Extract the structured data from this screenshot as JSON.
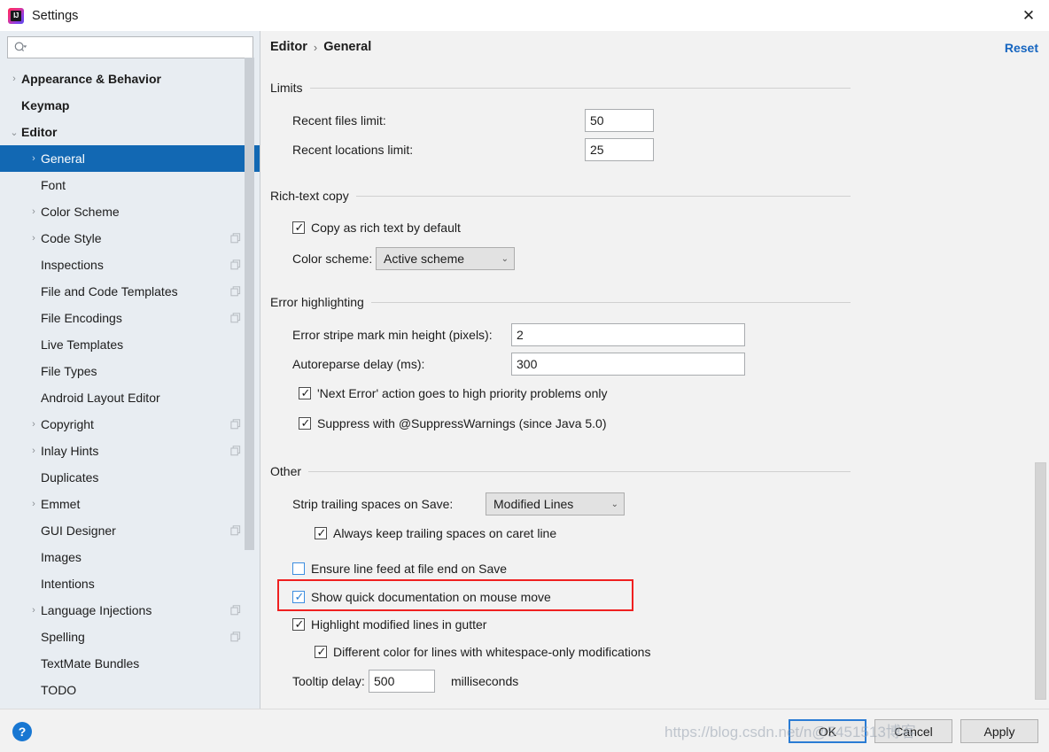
{
  "window": {
    "title": "Settings",
    "logo_text": "IJ",
    "close_label": "✕"
  },
  "sidebar": {
    "search": {
      "placeholder": "",
      "value": "",
      "icon": "search-icon"
    },
    "items": [
      {
        "label": "Appearance & Behavior",
        "level": 0,
        "chevron": "collapsed",
        "badge": false,
        "selected": false
      },
      {
        "label": "Keymap",
        "level": 0,
        "chevron": "none",
        "badge": false,
        "selected": false
      },
      {
        "label": "Editor",
        "level": 0,
        "chevron": "expanded",
        "badge": false,
        "selected": false
      },
      {
        "label": "General",
        "level": 1,
        "chevron": "collapsed",
        "badge": false,
        "selected": true
      },
      {
        "label": "Font",
        "level": 1,
        "chevron": "none",
        "badge": false,
        "selected": false
      },
      {
        "label": "Color Scheme",
        "level": 1,
        "chevron": "collapsed",
        "badge": false,
        "selected": false
      },
      {
        "label": "Code Style",
        "level": 1,
        "chevron": "collapsed",
        "badge": true,
        "selected": false
      },
      {
        "label": "Inspections",
        "level": 1,
        "chevron": "none",
        "badge": true,
        "selected": false
      },
      {
        "label": "File and Code Templates",
        "level": 1,
        "chevron": "none",
        "badge": true,
        "selected": false
      },
      {
        "label": "File Encodings",
        "level": 1,
        "chevron": "none",
        "badge": true,
        "selected": false
      },
      {
        "label": "Live Templates",
        "level": 1,
        "chevron": "none",
        "badge": false,
        "selected": false
      },
      {
        "label": "File Types",
        "level": 1,
        "chevron": "none",
        "badge": false,
        "selected": false
      },
      {
        "label": "Android Layout Editor",
        "level": 1,
        "chevron": "none",
        "badge": false,
        "selected": false
      },
      {
        "label": "Copyright",
        "level": 1,
        "chevron": "collapsed",
        "badge": true,
        "selected": false
      },
      {
        "label": "Inlay Hints",
        "level": 1,
        "chevron": "collapsed",
        "badge": true,
        "selected": false
      },
      {
        "label": "Duplicates",
        "level": 1,
        "chevron": "none",
        "badge": false,
        "selected": false
      },
      {
        "label": "Emmet",
        "level": 1,
        "chevron": "collapsed",
        "badge": false,
        "selected": false
      },
      {
        "label": "GUI Designer",
        "level": 1,
        "chevron": "none",
        "badge": true,
        "selected": false
      },
      {
        "label": "Images",
        "level": 1,
        "chevron": "none",
        "badge": false,
        "selected": false
      },
      {
        "label": "Intentions",
        "level": 1,
        "chevron": "none",
        "badge": false,
        "selected": false
      },
      {
        "label": "Language Injections",
        "level": 1,
        "chevron": "collapsed",
        "badge": true,
        "selected": false
      },
      {
        "label": "Spelling",
        "level": 1,
        "chevron": "none",
        "badge": true,
        "selected": false
      },
      {
        "label": "TextMate Bundles",
        "level": 1,
        "chevron": "none",
        "badge": false,
        "selected": false
      },
      {
        "label": "TODO",
        "level": 1,
        "chevron": "none",
        "badge": false,
        "selected": false
      }
    ]
  },
  "content": {
    "breadcrumb": {
      "parent": "Editor",
      "separator": "›",
      "current": "General"
    },
    "reset_label": "Reset",
    "limits": {
      "title": "Limits",
      "recent_files_label": "Recent files limit:",
      "recent_files_value": "50",
      "recent_locations_label": "Recent locations limit:",
      "recent_locations_value": "25"
    },
    "rich_text_copy": {
      "title": "Rich-text copy",
      "copy_rich_label": "Copy as rich text by default",
      "copy_rich_checked": true,
      "color_scheme_label": "Color scheme:",
      "color_scheme_value": "Active scheme"
    },
    "error_highlighting": {
      "title": "Error highlighting",
      "stripe_label": "Error stripe mark min height (pixels):",
      "stripe_value": "2",
      "autoreparse_label": "Autoreparse delay (ms):",
      "autoreparse_value": "300",
      "next_error_label": "'Next Error' action goes to high priority problems only",
      "next_error_checked": true,
      "suppress_label": "Suppress with @SuppressWarnings (since Java 5.0)",
      "suppress_checked": true
    },
    "other": {
      "title": "Other",
      "strip_label": "Strip trailing spaces on Save:",
      "strip_value": "Modified Lines",
      "always_keep_label": "Always keep trailing spaces on caret line",
      "always_keep_checked": true,
      "ensure_lf_label": "Ensure line feed at file end on Save",
      "ensure_lf_checked": false,
      "quick_doc_label": "Show quick documentation on mouse move",
      "quick_doc_checked": true,
      "highlight_modified_label": "Highlight modified lines in gutter",
      "highlight_modified_checked": true,
      "different_color_label": "Different color for lines with whitespace-only modifications",
      "different_color_checked": true,
      "tooltip_delay_label": "Tooltip delay:",
      "tooltip_delay_value": "500",
      "tooltip_delay_units": "milliseconds"
    }
  },
  "footer": {
    "help_label": "?",
    "ok_label": "OK",
    "cancel_label": "Cancel",
    "apply_label": "Apply"
  },
  "overlay": {
    "watermark": "https://blog.csdn.net/n@5451513博客"
  },
  "colors": {
    "accent": "#1268b3",
    "link": "#1565c0",
    "highlight_box": "#ef2020",
    "sidebar_bg": "#e8edf2",
    "panel_bg": "#f2f2f2",
    "focus_ring": "#2a7cd4"
  }
}
